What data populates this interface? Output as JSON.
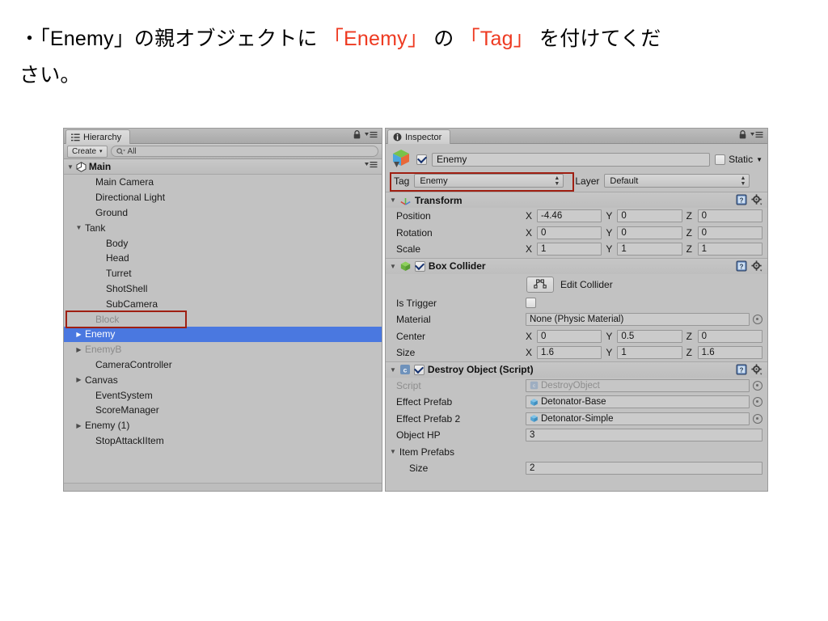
{
  "caption": {
    "line1_a": "・「Enemy」の親オブジェクトに ",
    "line1_hl1": "「Enemy」",
    "line1_b": " の ",
    "line1_hl2": "「Tag」",
    "line1_c": " を付けてくだ",
    "line2": "さい。",
    "highlight_color": "#ee3a21"
  },
  "hierarchy": {
    "tab_label": "Hierarchy",
    "tab_icon": "hierarchy-list-icon",
    "create_button": "Create",
    "create_arrow": "▾",
    "search_placeholder": "All",
    "search_icon": "search-icon",
    "lock_icon": "lock-icon",
    "menu_icon": "hamburger-menu-icon",
    "root": {
      "label": "Main",
      "icon": "unity-logo-icon",
      "expanded": true
    },
    "items": [
      {
        "label": "Main Camera",
        "indent": 2,
        "arrow": "",
        "state": "normal",
        "selected": false
      },
      {
        "label": "Directional Light",
        "indent": 2,
        "arrow": "",
        "state": "normal",
        "selected": false
      },
      {
        "label": "Ground",
        "indent": 2,
        "arrow": "",
        "state": "normal",
        "selected": false
      },
      {
        "label": "Tank",
        "indent": 1,
        "arrow": "▼",
        "state": "normal",
        "selected": false
      },
      {
        "label": "Body",
        "indent": 3,
        "arrow": "",
        "state": "normal",
        "selected": false
      },
      {
        "label": "Head",
        "indent": 3,
        "arrow": "",
        "state": "normal",
        "selected": false
      },
      {
        "label": "Turret",
        "indent": 3,
        "arrow": "",
        "state": "normal",
        "selected": false
      },
      {
        "label": "ShotShell",
        "indent": 3,
        "arrow": "",
        "state": "normal",
        "selected": false
      },
      {
        "label": "SubCamera",
        "indent": 3,
        "arrow": "",
        "state": "normal",
        "selected": false
      },
      {
        "label": "Block",
        "indent": 2,
        "arrow": "",
        "state": "inactive",
        "selected": false
      },
      {
        "label": "Enemy",
        "indent": 1,
        "arrow": "▶",
        "state": "normal",
        "selected": true
      },
      {
        "label": "EnemyB",
        "indent": 1,
        "arrow": "▶",
        "state": "inactive",
        "selected": false
      },
      {
        "label": "CameraController",
        "indent": 2,
        "arrow": "",
        "state": "normal",
        "selected": false
      },
      {
        "label": "Canvas",
        "indent": 1,
        "arrow": "▶",
        "state": "normal",
        "selected": false
      },
      {
        "label": "EventSystem",
        "indent": 2,
        "arrow": "",
        "state": "normal",
        "selected": false
      },
      {
        "label": "ScoreManager",
        "indent": 2,
        "arrow": "",
        "state": "normal",
        "selected": false
      },
      {
        "label": "Enemy (1)",
        "indent": 1,
        "arrow": "▶",
        "state": "normal",
        "selected": false
      },
      {
        "label": "StopAttackIItem",
        "indent": 2,
        "arrow": "",
        "state": "normal",
        "selected": false
      }
    ],
    "selection_color": "#4a78e0"
  },
  "inspector": {
    "tab_label": "Inspector",
    "tab_icon": "info-circle-icon",
    "lock_icon": "lock-icon",
    "menu_icon": "hamburger-menu-icon",
    "object": {
      "icon": "gameobject-cube-icon",
      "enabled": true,
      "name": "Enemy",
      "static_label": "Static",
      "static_checked": false,
      "static_arrow": "▼"
    },
    "tag_label": "Tag",
    "tag_value": "Enemy",
    "layer_label": "Layer",
    "layer_value": "Default",
    "components": [
      {
        "name": "Transform",
        "icon": "transform-axis-icon",
        "has_checkbox": false,
        "help_icon": "help-book-icon",
        "gear_icon": "gear-icon",
        "rows": [
          {
            "label": "Position",
            "type": "xyz",
            "x": "-4.46",
            "y": "0",
            "z": "0"
          },
          {
            "label": "Rotation",
            "type": "xyz",
            "x": "0",
            "y": "0",
            "z": "0"
          },
          {
            "label": "Scale",
            "type": "xyz",
            "x": "1",
            "y": "1",
            "z": "1"
          }
        ]
      },
      {
        "name": "Box Collider",
        "icon": "box-collider-icon",
        "has_checkbox": true,
        "checked": true,
        "help_icon": "help-book-icon",
        "gear_icon": "gear-icon",
        "edit_collider_label": "Edit Collider",
        "edit_collider_icon": "edit-collider-icon",
        "rows": [
          {
            "label": "Is Trigger",
            "type": "checkbox",
            "checked": false
          },
          {
            "label": "Material",
            "type": "object",
            "value": "None (Physic Material)",
            "picker": true
          },
          {
            "label": "Center",
            "type": "xyz",
            "x": "0",
            "y": "0.5",
            "z": "0"
          },
          {
            "label": "Size",
            "type": "xyz",
            "x": "1.6",
            "y": "1",
            "z": "1.6"
          }
        ]
      },
      {
        "name": "Destroy Object (Script)",
        "icon": "script-icon",
        "has_checkbox": true,
        "checked": true,
        "help_icon": "help-book-icon",
        "gear_icon": "gear-icon",
        "rows": [
          {
            "label": "Script",
            "type": "object",
            "value": "DestroyObject",
            "dim": true,
            "picker": true,
            "chip": "script-icon"
          },
          {
            "label": "Effect Prefab",
            "type": "object",
            "value": "Detonator-Base",
            "dim": false,
            "picker": true,
            "chip": "prefab-cube-icon"
          },
          {
            "label": "Effect Prefab 2",
            "type": "object",
            "value": "Detonator-Simple",
            "dim": false,
            "picker": true,
            "chip": "prefab-cube-icon"
          },
          {
            "label": "Object HP",
            "type": "text",
            "value": "3"
          },
          {
            "label": "Item Prefabs",
            "type": "foldout",
            "arrow": "▼"
          },
          {
            "label": "Size",
            "type": "text",
            "value": "2",
            "indent": true
          }
        ]
      }
    ]
  },
  "annotations": [
    {
      "name": "tag-field-highlight",
      "color": "#9f1f12"
    },
    {
      "name": "enemy-row-highlight",
      "color": "#9f1f12"
    }
  ]
}
